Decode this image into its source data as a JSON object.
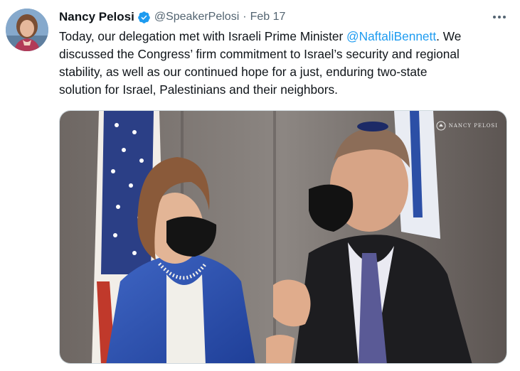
{
  "tweet": {
    "author_name": "Nancy Pelosi",
    "handle": "@SpeakerPelosi",
    "separator": "·",
    "date": "Feb 17",
    "text_before_mention": "Today, our delegation met with Israeli Prime Minister ",
    "mention": "@NaftaliBennett",
    "text_after_mention": ". We",
    "text_line_2": "discussed the Congress’ firm commitment to Israel’s security and regional",
    "text_line_3": "stability, as well as our continued hope for a just, enduring two-state",
    "text_line_4": "solution for Israel, Palestinians and their neighbors.",
    "watermark_text": "NANCY PELOSI"
  },
  "icons": {
    "verified": "verified-badge-icon",
    "more": "more-options-icon",
    "seal": "seal-icon"
  },
  "colors": {
    "link": "#1d9bf0",
    "text": "#0f1419",
    "secondary": "#536471",
    "verified": "#1d9bf0"
  }
}
